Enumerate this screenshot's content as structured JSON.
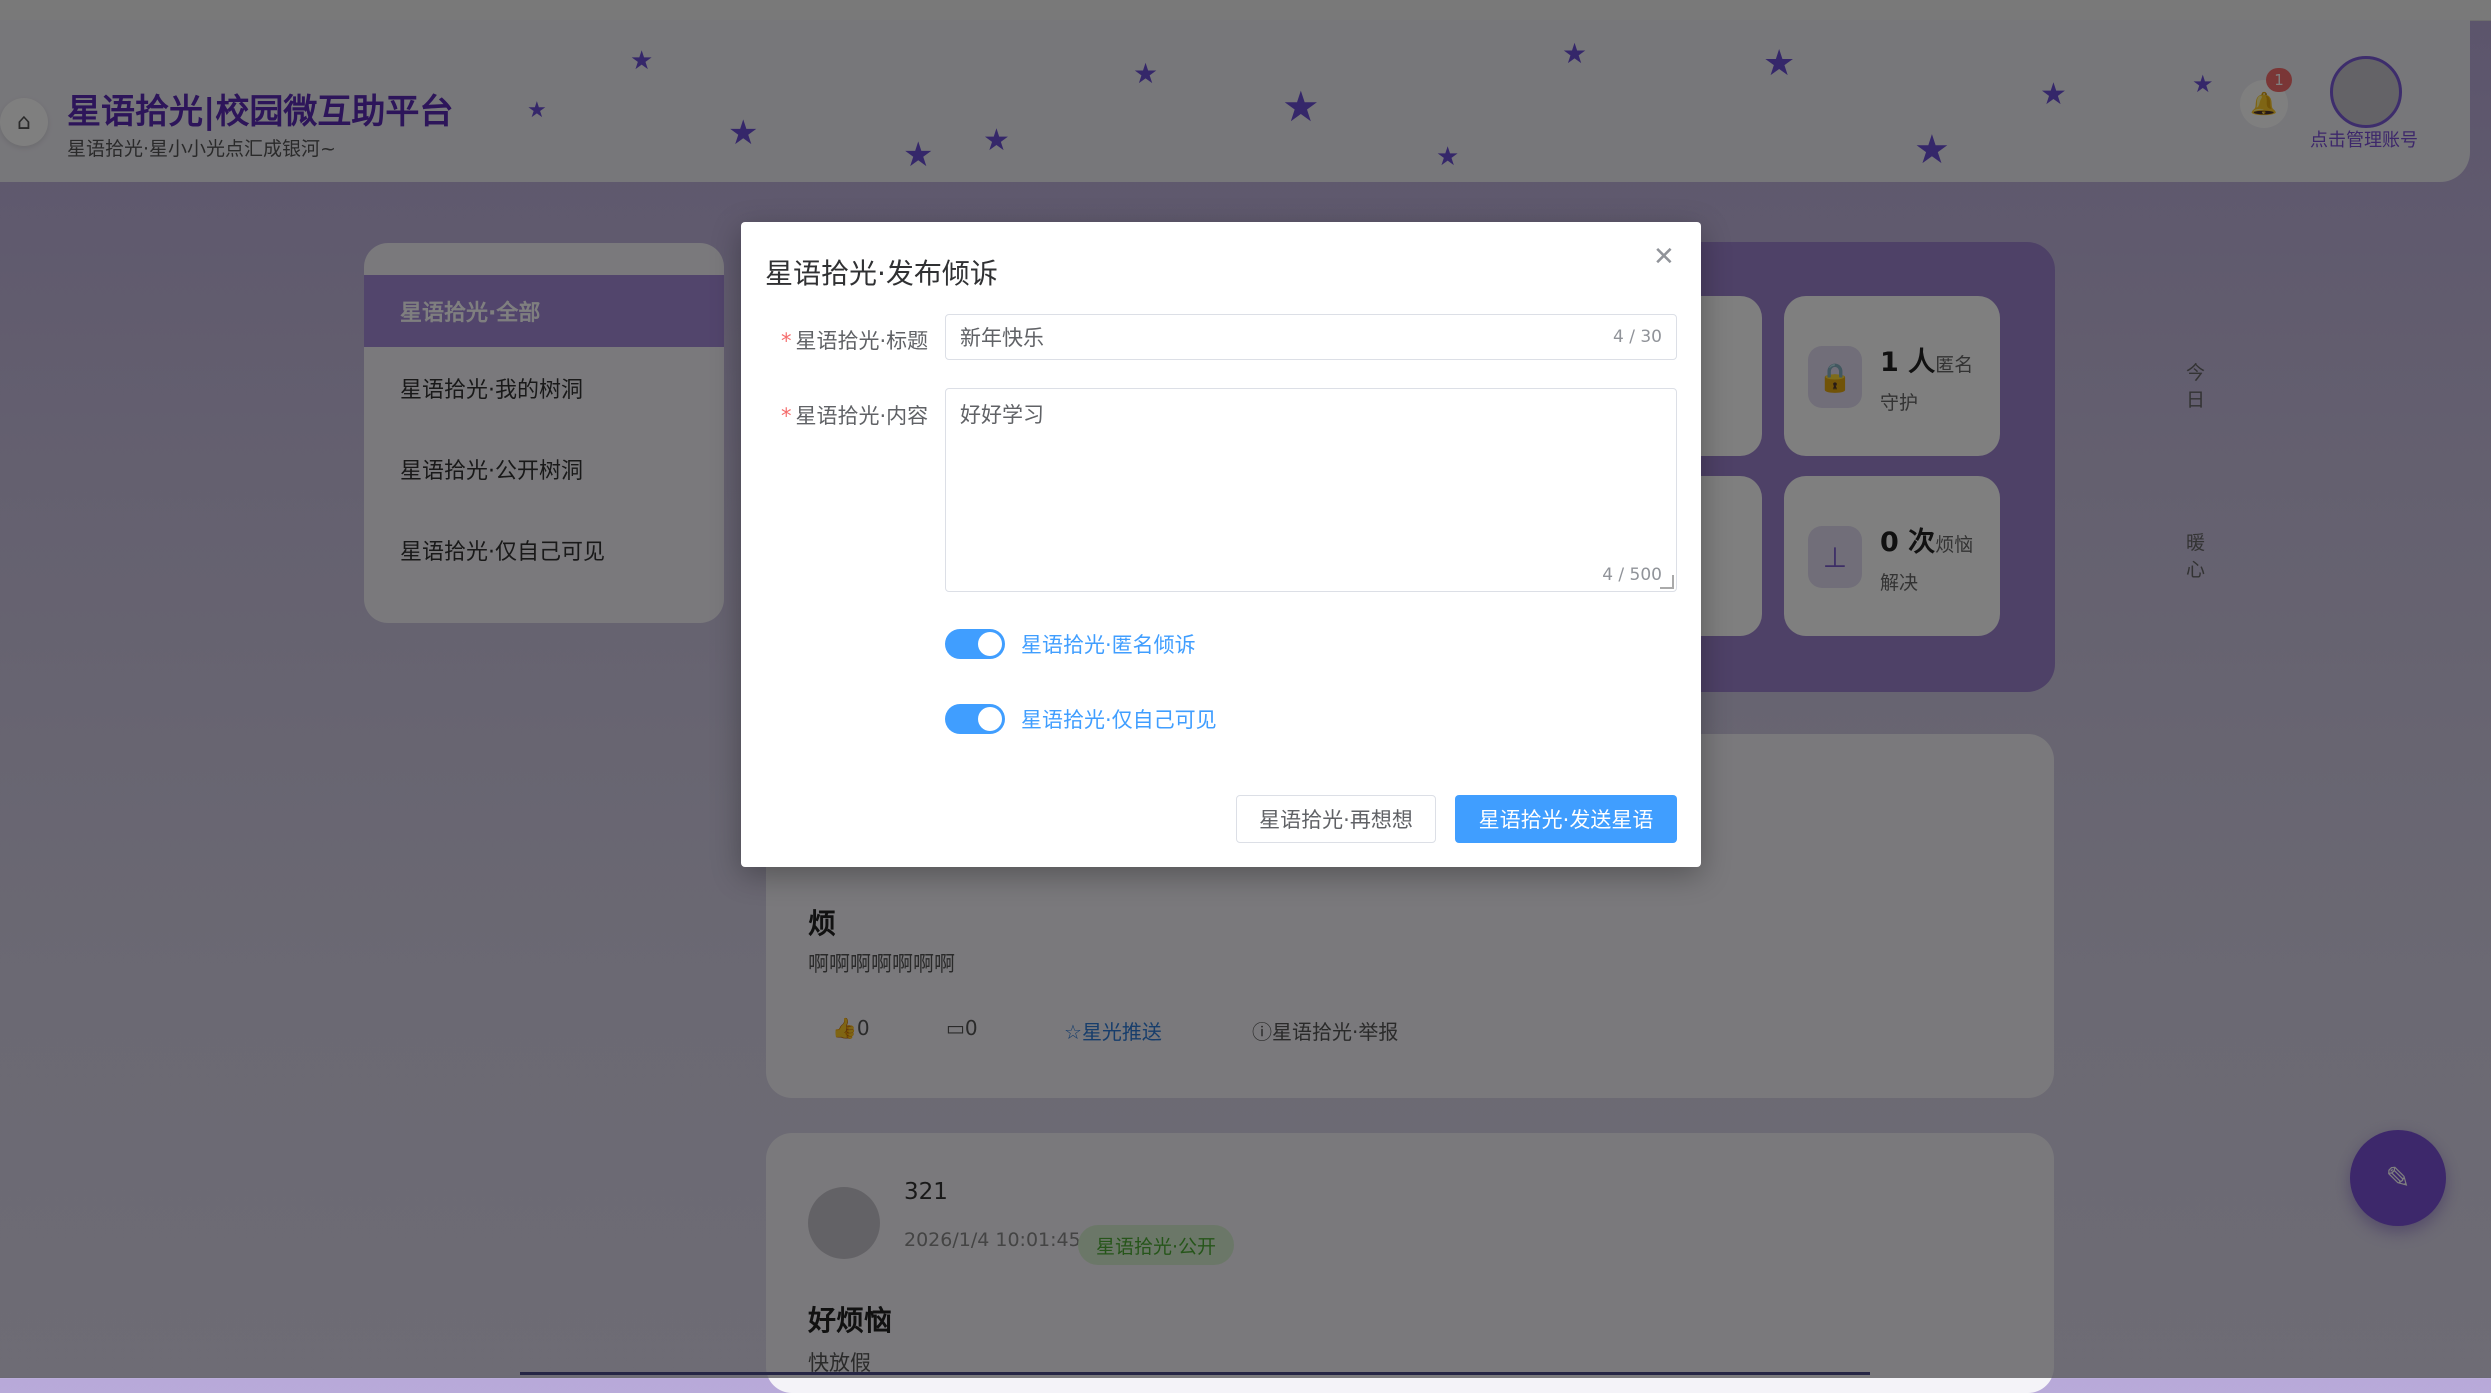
{
  "header": {
    "title": "星语拾光|校园微互助平台",
    "subtitle": "星语拾光·星小小光点汇成银河~",
    "notification_count": "1",
    "manage_account": "点击管理账号"
  },
  "sidebar": {
    "items": [
      {
        "label": "星语拾光·全部"
      },
      {
        "label": "星语拾光·我的树洞"
      },
      {
        "label": "星语拾光·公开树洞"
      },
      {
        "label": "星语拾光·仅自己可见"
      }
    ]
  },
  "stats": {
    "partial_top": "今日",
    "partial_bottom": "暖心",
    "anon": {
      "number": "1 人",
      "suffix": "匿名",
      "label": "守护"
    },
    "solved": {
      "number": "0 次",
      "suffix": "烦恼",
      "label": "解决"
    }
  },
  "posts": [
    {
      "title": "烦",
      "body": "啊啊啊啊啊啊啊",
      "likes": "0",
      "comments": "0",
      "push_label": "星光推送",
      "report_label": "星语拾光·举报"
    },
    {
      "user": "321",
      "time": "2026/1/4 10:01:45",
      "tag": "星语拾光·公开",
      "title": "好烦恼",
      "body": "快放假"
    }
  ],
  "dialog": {
    "title": "星语拾光·发布倾诉",
    "title_label": "星语拾光·标题",
    "title_value": "新年快乐",
    "title_count": "4 / 30",
    "content_label": "星语拾光·内容",
    "content_value": "好好学习",
    "content_count": "4 / 500",
    "switch_anon": "星语拾光·匿名倾诉",
    "switch_private": "星语拾光·仅自己可见",
    "cancel": "星语拾光·再想想",
    "confirm": "星语拾光·发送星语"
  },
  "colors": {
    "primary": "#409eff",
    "brand": "#5b2bb5",
    "accent_purple": "#7a50d6"
  }
}
